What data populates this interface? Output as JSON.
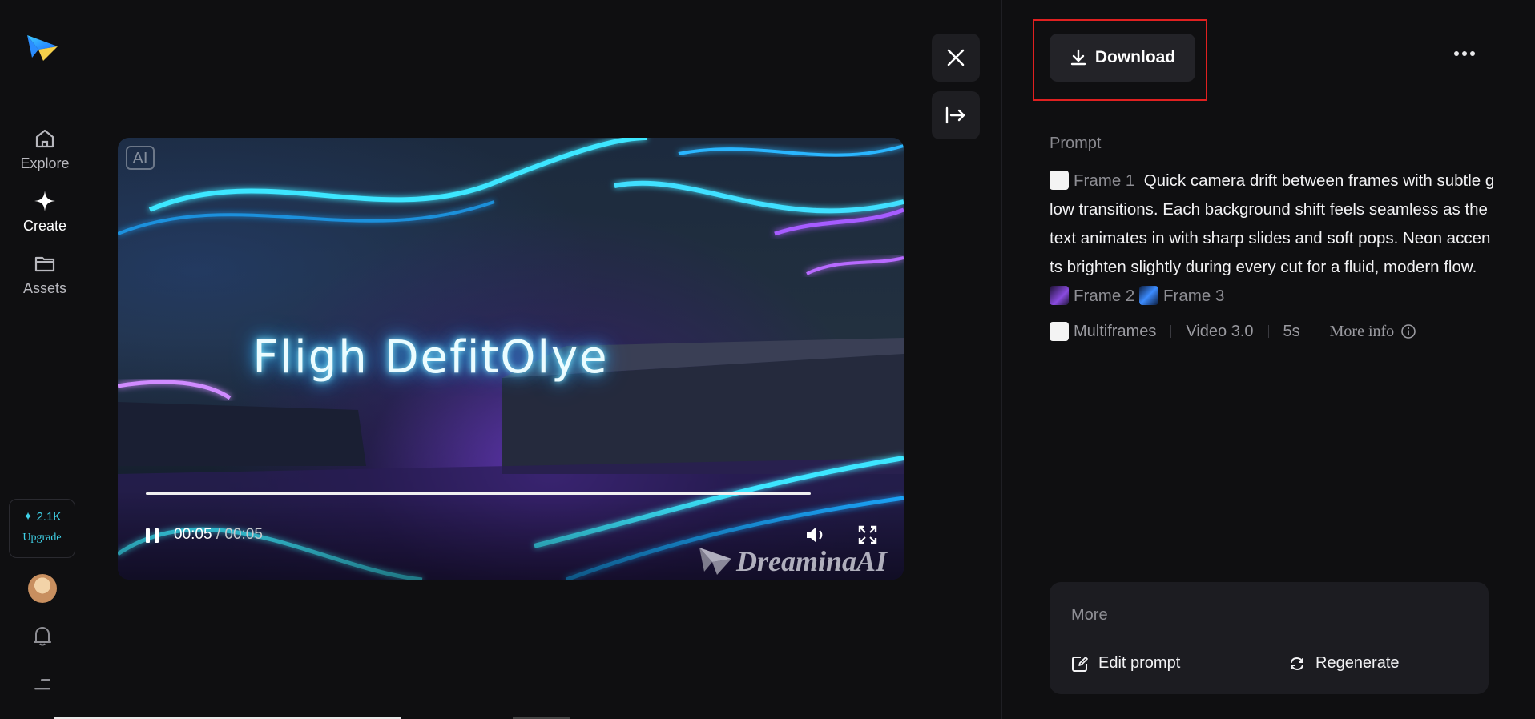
{
  "sidebar": {
    "items": [
      {
        "label": "Explore",
        "icon": "home-icon"
      },
      {
        "label": "Create",
        "icon": "sparkle-icon"
      },
      {
        "label": "Assets",
        "icon": "folder-icon"
      }
    ],
    "credits": {
      "amount": "✦ 2.1K",
      "upgrade_label": "Upgrade"
    }
  },
  "video": {
    "badge": "AI",
    "title_text": "Fligh DefitOlye",
    "current_time": "00:05",
    "separator": " / ",
    "total_time": "00:05",
    "progress": 1.0,
    "watermark": "DreaminaAI"
  },
  "toolbar": {
    "download_label": "Download"
  },
  "prompt": {
    "label": "Prompt",
    "frame1": "Frame 1",
    "text": "Quick camera drift between frames with subtle glow transitions. Each background shift feels seamless as the text animates in with sharp slides and soft pops. Neon accents brighten slightly during every cut for a fluid, modern flow.",
    "frame2": "Frame 2",
    "frame3": "Frame 3"
  },
  "meta": {
    "mode": "Multiframes",
    "model": "Video 3.0",
    "duration": "5s",
    "more_info": "More info"
  },
  "more_panel": {
    "title": "More",
    "edit_prompt": "Edit prompt",
    "regenerate": "Regenerate"
  },
  "colors": {
    "background": "#0f0f11",
    "accent": "#3fd0e6",
    "highlight": "#e02020"
  }
}
